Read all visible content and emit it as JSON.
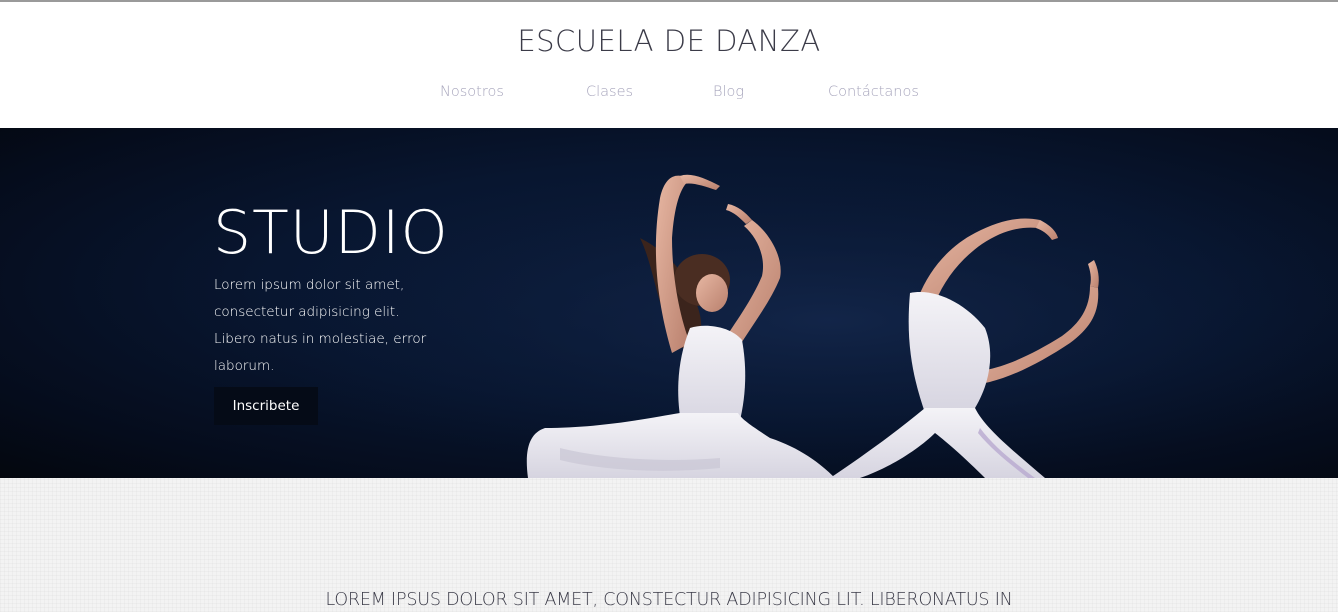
{
  "header": {
    "site_title": "ESCUELA DE DANZA",
    "nav": [
      {
        "label": "Nosotros"
      },
      {
        "label": "Clases"
      },
      {
        "label": "Blog"
      },
      {
        "label": "Contáctanos"
      }
    ]
  },
  "hero": {
    "title": "STUDIO",
    "description": "Lorem ipsum dolor sit amet, consectetur adipisicing elit. Libero natus in molestiae, error laborum.",
    "button_label": "Inscribete",
    "image_alt": "two-dancers-photo"
  },
  "intro": {
    "heading": "LOREM IPSUS DOLOR SIT AMET, CONSTECTUR ADIPISICING LIT. LIBERONATUS IN"
  },
  "colors": {
    "hero_background": "#081630",
    "button_background": "#050b17",
    "nav_text": "#a7a5bc",
    "title_text": "#3b3b48"
  }
}
